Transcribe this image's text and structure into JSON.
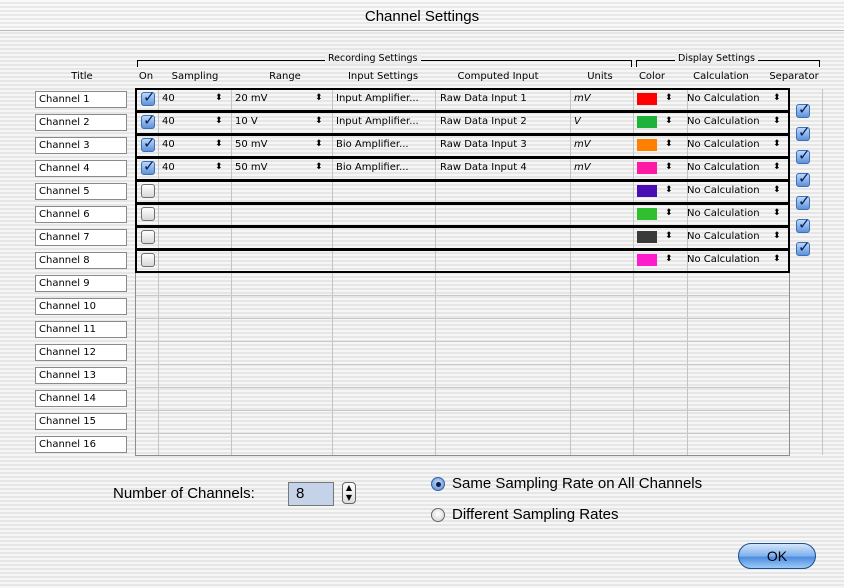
{
  "window": {
    "title": "Channel Settings"
  },
  "groups": {
    "recording": "Recording Settings",
    "display": "Display Settings"
  },
  "columns": {
    "title": "Title",
    "on": "On",
    "sampling": "Sampling",
    "range": "Range",
    "input_settings": "Input Settings",
    "computed_input": "Computed Input",
    "units": "Units",
    "color": "Color",
    "calculation": "Calculation",
    "separator": "Separator"
  },
  "channels": [
    {
      "title": "Channel 1",
      "on": true,
      "sampling": "40",
      "range": "20 mV",
      "input": "Input Amplifier...",
      "computed": "Raw Data Input 1",
      "units": "mV",
      "color": "#ff0000",
      "calculation": "No Calculation",
      "separator": true
    },
    {
      "title": "Channel 2",
      "on": true,
      "sampling": "40",
      "range": "10 V",
      "input": "Input Amplifier...",
      "computed": "Raw Data Input 2",
      "units": "V",
      "color": "#1fb23a",
      "calculation": "No Calculation",
      "separator": true
    },
    {
      "title": "Channel 3",
      "on": true,
      "sampling": "40",
      "range": "50 mV",
      "input": "Bio Amplifier...",
      "computed": "Raw Data Input 3",
      "units": "mV",
      "color": "#ff8000",
      "calculation": "No Calculation",
      "separator": true
    },
    {
      "title": "Channel 4",
      "on": true,
      "sampling": "40",
      "range": "50 mV",
      "input": "Bio Amplifier...",
      "computed": "Raw Data Input 4",
      "units": "mV",
      "color": "#ff1aa6",
      "calculation": "No Calculation",
      "separator": true
    },
    {
      "title": "Channel 5",
      "on": false,
      "sampling": "",
      "range": "",
      "input": "",
      "computed": "",
      "units": "",
      "color": "#4a0cb4",
      "calculation": "No Calculation",
      "separator": true
    },
    {
      "title": "Channel 6",
      "on": false,
      "sampling": "",
      "range": "",
      "input": "",
      "computed": "",
      "units": "",
      "color": "#2fbf2f",
      "calculation": "No Calculation",
      "separator": true
    },
    {
      "title": "Channel 7",
      "on": false,
      "sampling": "",
      "range": "",
      "input": "",
      "computed": "",
      "units": "",
      "color": "#3a3a3a",
      "calculation": "No Calculation",
      "separator": true
    },
    {
      "title": "Channel 8",
      "on": false,
      "sampling": "",
      "range": "",
      "input": "",
      "computed": "",
      "units": "",
      "color": "#ff1acd",
      "calculation": "No Calculation"
    },
    {
      "title": "Channel 9"
    },
    {
      "title": "Channel 10"
    },
    {
      "title": "Channel 11"
    },
    {
      "title": "Channel 12"
    },
    {
      "title": "Channel 13"
    },
    {
      "title": "Channel 14"
    },
    {
      "title": "Channel 15"
    },
    {
      "title": "Channel 16"
    }
  ],
  "footer": {
    "num_channels_label": "Number of Channels:",
    "num_channels_value": "8",
    "radio_same": "Same Sampling Rate on All Channels",
    "radio_different": "Different Sampling Rates",
    "selected_radio": "same",
    "ok": "OK"
  },
  "icons": {
    "checkmark": "checkmark-icon",
    "popup_arrows": "updown-arrows-icon",
    "stepper": "stepper-arrows-icon"
  }
}
